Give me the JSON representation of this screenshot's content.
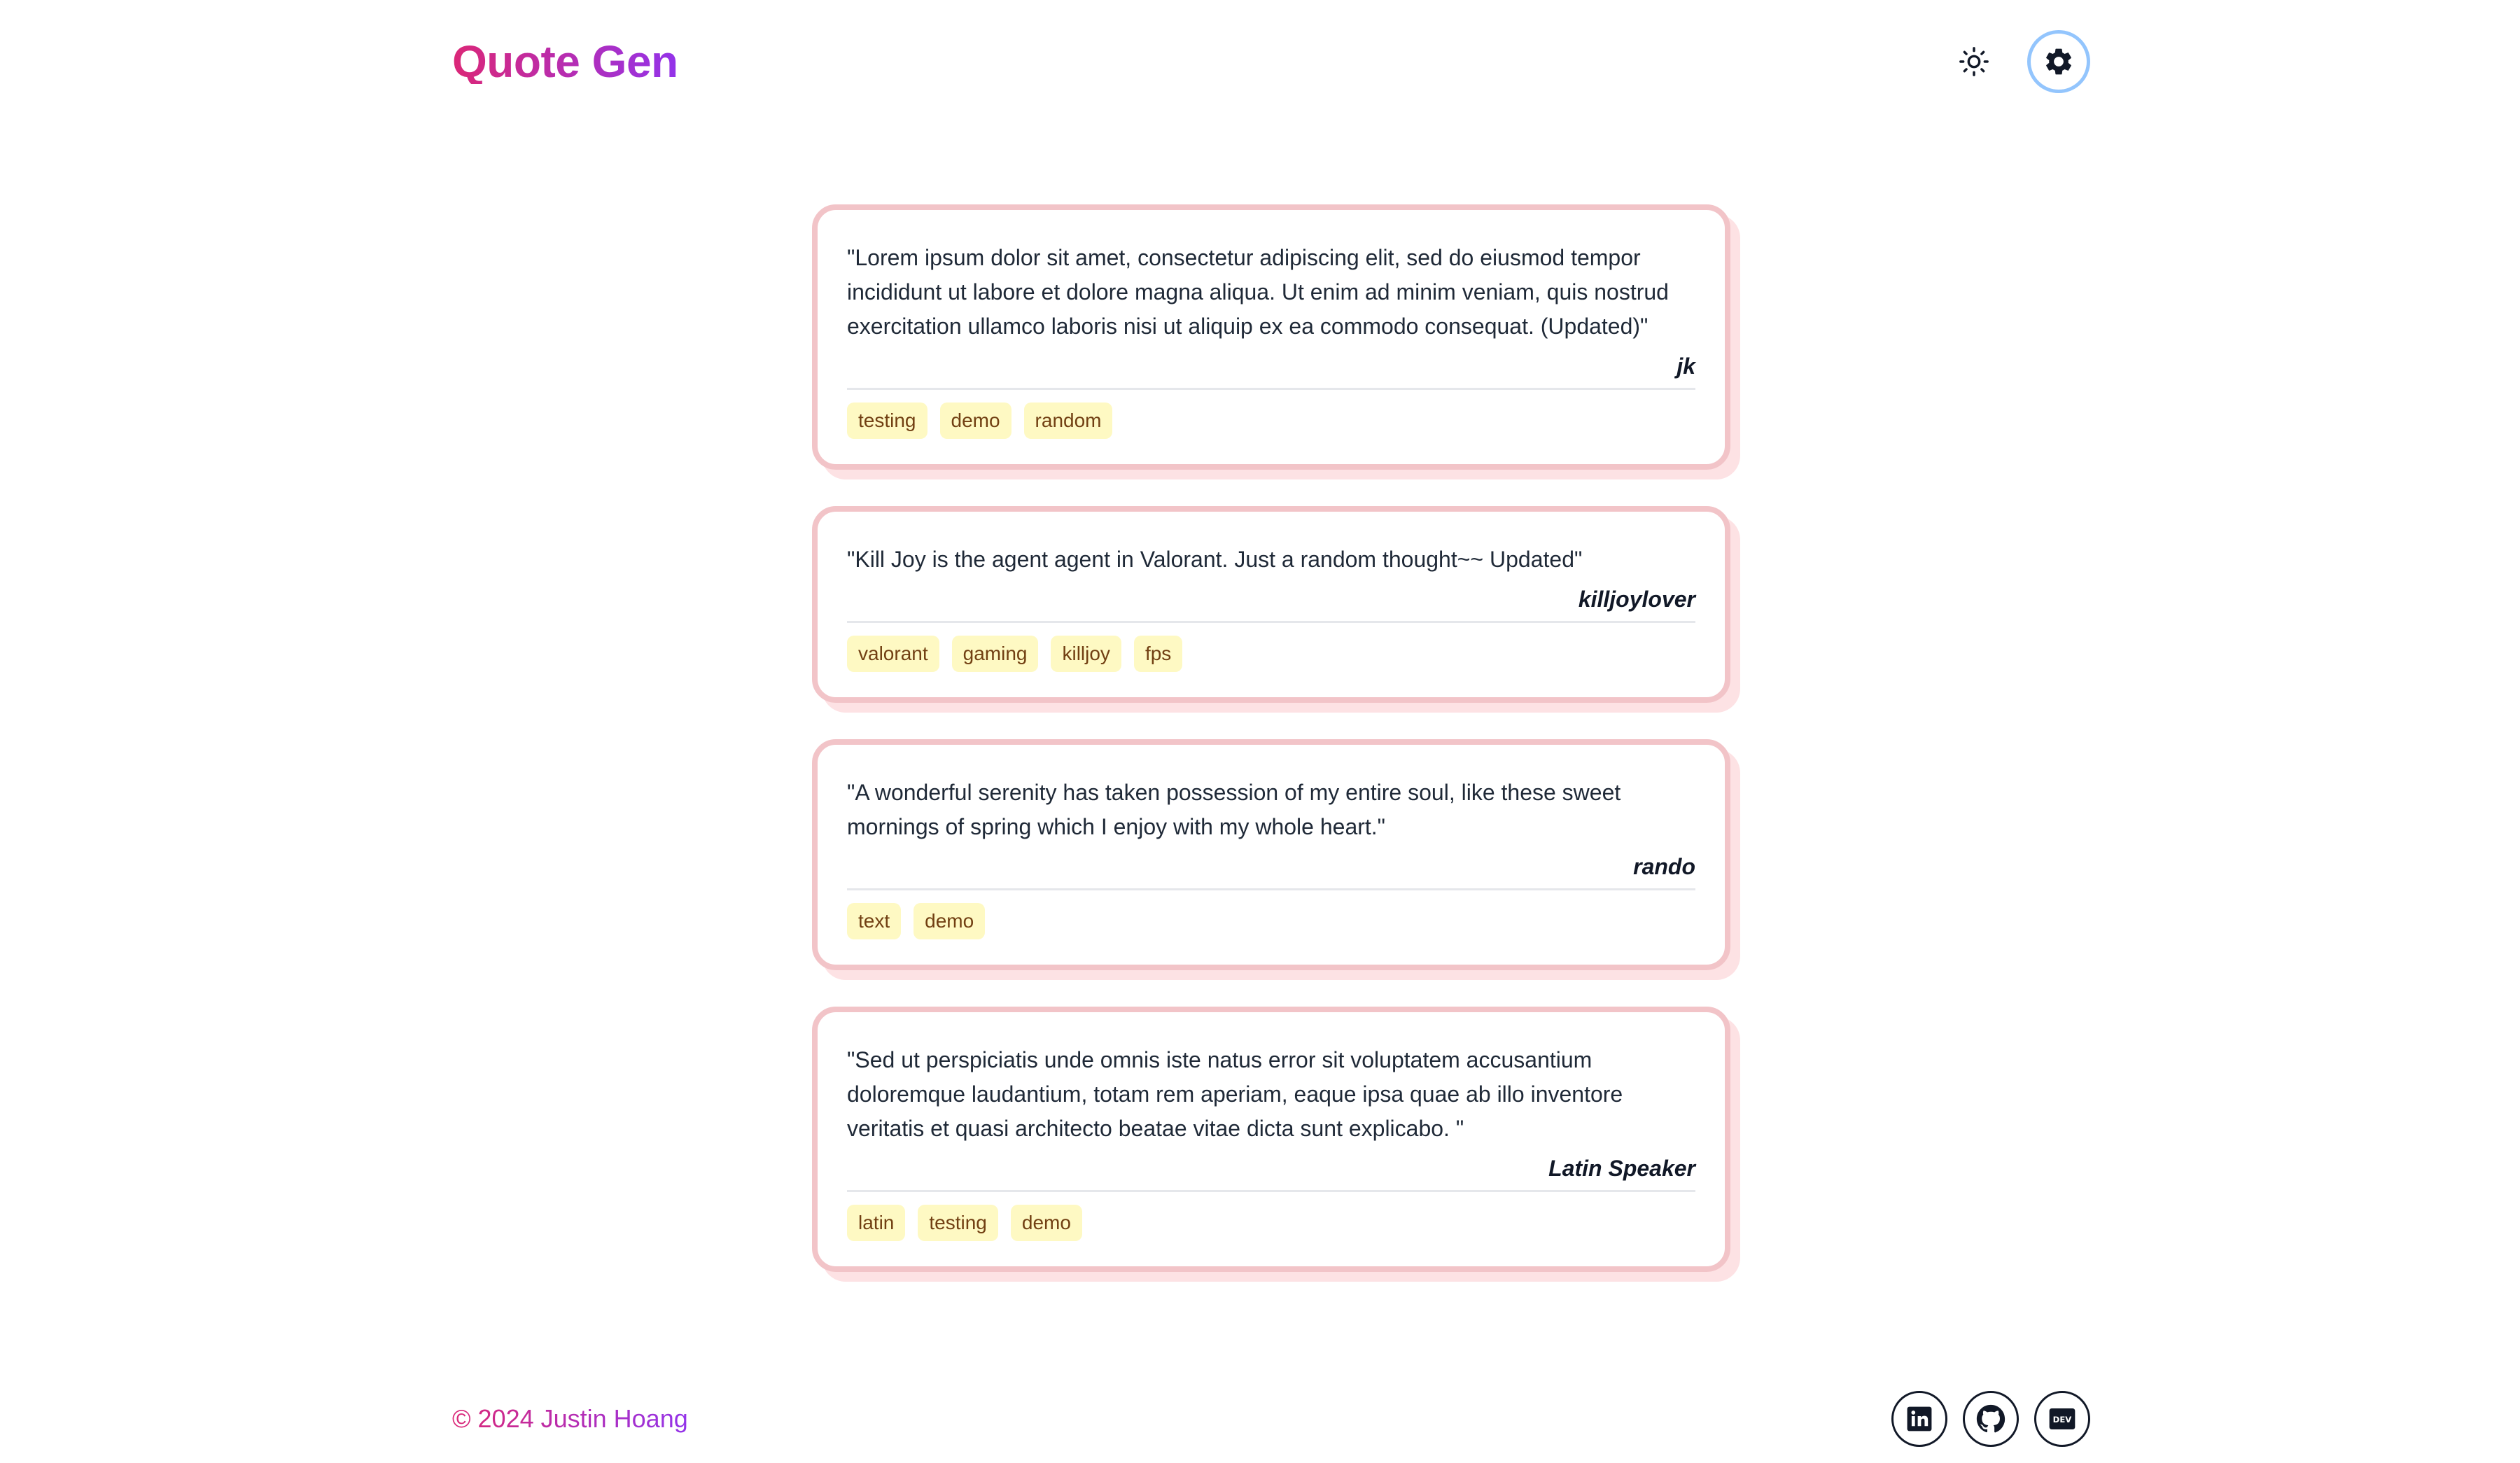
{
  "header": {
    "logo": "Quote Gen",
    "theme_toggle_icon": "sun-icon",
    "settings_icon": "gear-icon"
  },
  "quotes": [
    {
      "text": "\"Lorem ipsum dolor sit amet, consectetur adipiscing elit, sed do eiusmod tempor incididunt ut labore et dolore magna aliqua. Ut enim ad minim veniam, quis nostrud exercitation ullamco laboris nisi ut aliquip ex ea commodo consequat. (Updated)\"",
      "author": "jk",
      "tags": [
        "testing",
        "demo",
        "random"
      ]
    },
    {
      "text": "\"Kill Joy is the agent agent in Valorant. Just a random thought~~ Updated\"",
      "author": "killjoylover",
      "tags": [
        "valorant",
        "gaming",
        "killjoy",
        "fps"
      ]
    },
    {
      "text": "\"A wonderful serenity has taken possession of my entire soul, like these sweet mornings of spring which I enjoy with my whole heart.\"",
      "author": "rando",
      "tags": [
        "text",
        "demo"
      ]
    },
    {
      "text": "\"Sed ut perspiciatis unde omnis iste natus error sit voluptatem accusantium doloremque laudantium, totam rem aperiam, eaque ipsa quae ab illo inventore veritatis et quasi architecto beatae vitae dicta sunt explicabo. \"",
      "author": "Latin Speaker",
      "tags": [
        "latin",
        "testing",
        "demo"
      ]
    }
  ],
  "footer": {
    "copyright": "© 2024 Justin Hoang",
    "social": [
      {
        "name": "linkedin",
        "icon": "linkedin-icon"
      },
      {
        "name": "github",
        "icon": "github-icon"
      },
      {
        "name": "dev",
        "icon": "dev-icon"
      }
    ]
  },
  "colors": {
    "brand_gradient_start": "#db2777",
    "brand_gradient_end": "#9333ea",
    "card_border": "#f2c4c8",
    "card_shadow": "#fde2e4",
    "tag_bg": "#fef9c3",
    "settings_ring": "#93c5fd"
  }
}
